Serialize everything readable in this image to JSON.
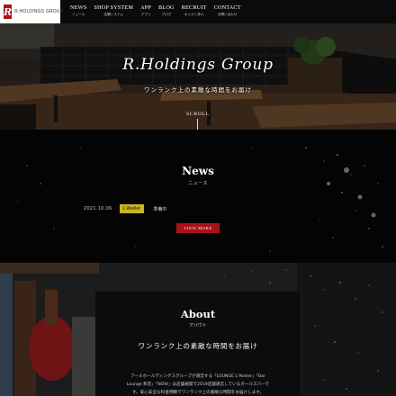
{
  "header": {
    "logo_mark": "R",
    "logo_text": "R.HOLDINGS GROUP",
    "nav": [
      {
        "en": "NEWS",
        "jp": "ニュース"
      },
      {
        "en": "SHOP SYSTEM",
        "jp": "店舗システム"
      },
      {
        "en": "APP",
        "jp": "アプリ"
      },
      {
        "en": "BLOG",
        "jp": "ブログ"
      },
      {
        "en": "RECRUIT",
        "jp": "キャスト求人"
      },
      {
        "en": "CONTACT",
        "jp": "お問い合わせ"
      }
    ]
  },
  "hero": {
    "title": "R.Holdings Group",
    "subtitle": "ワンランク上の素敵な時間をお届け",
    "scroll": "SCROLL"
  },
  "news": {
    "title": "News",
    "subtitle": "ニュース",
    "items": [
      {
        "date": "2021.10.06",
        "tag": "L'Atelier",
        "text": "準備中"
      }
    ],
    "view_more": "VIEW MORE"
  },
  "about": {
    "title": "About",
    "subtitle": "アバウト",
    "lead": "ワンランク上の素敵な時間をお届け",
    "body_1": "アールホールディングスグループが運営する「LOUNGE L'Atelier」「Bar",
    "body_2": "Lounge 和音」「NOW」は店舗展開で2019店舗運営しているガールズバーで",
    "body_3": "す。安心安全な料金明瞭でワンランク上の素敵な時間をお届けします。"
  },
  "colors": {
    "accent_red": "#a8111a",
    "tag_yellow": "#c9b520",
    "header_bg": "#0b0b0b"
  }
}
